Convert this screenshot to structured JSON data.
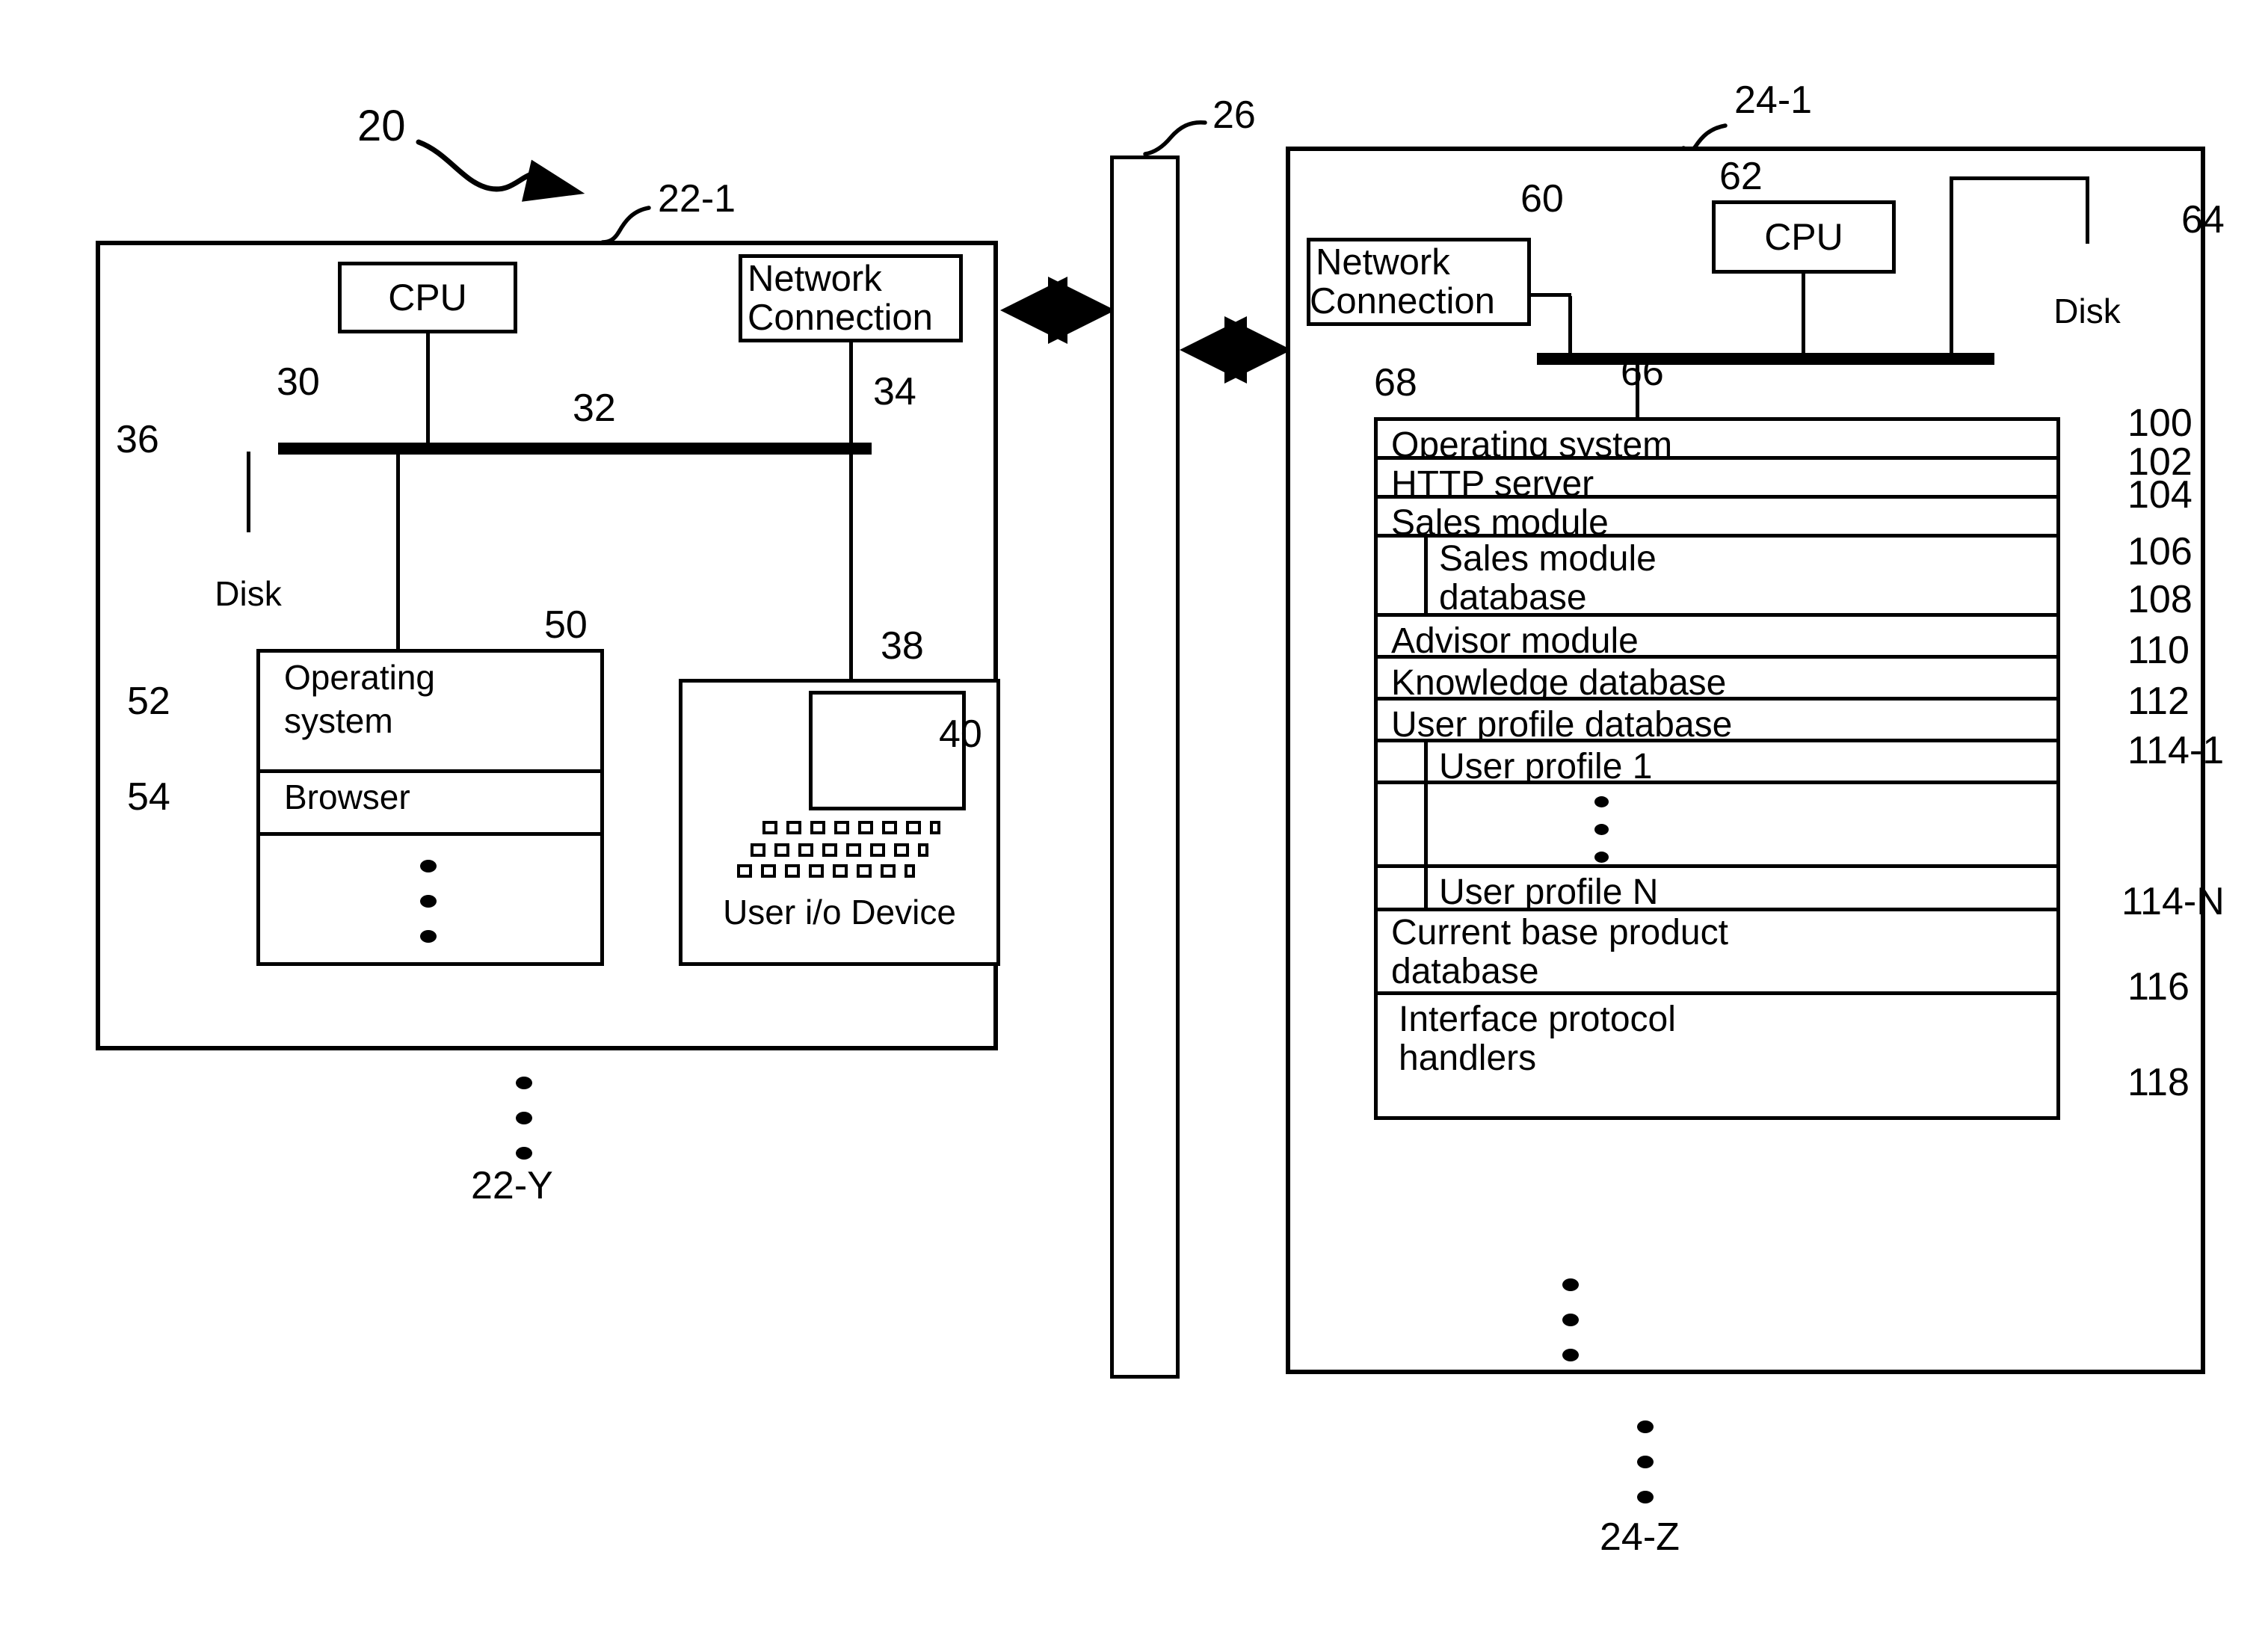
{
  "figure": {
    "type": "patent-system-block-diagram",
    "system_ref": "20"
  },
  "client": {
    "ref": "22-1",
    "bottom_ref": "22-Y",
    "cpu": {
      "label": "CPU",
      "ref": "30"
    },
    "bus": {
      "ref": "32"
    },
    "network_connection": {
      "label": "Network\nConnection",
      "line1": "Network",
      "line2": "Connection",
      "ref": "34"
    },
    "disk": {
      "label": "Disk",
      "ref": "36"
    },
    "memory": {
      "ref": "50",
      "rows": [
        {
          "label": "Operating system",
          "line1": "Operating",
          "line2": "system",
          "ref": "52"
        },
        {
          "label": "Browser",
          "ref": "54"
        },
        {
          "label": "",
          "ref": ""
        }
      ]
    },
    "user_io_device": {
      "label": "User i/o Device",
      "ref": "38",
      "monitor_ref": "40"
    }
  },
  "network": {
    "ref": "26"
  },
  "server": {
    "ref": "24-1",
    "bottom_ref": "24-Z",
    "network_connection": {
      "line1": "Network",
      "line2": "Connection",
      "ref": "60"
    },
    "cpu": {
      "label": "CPU",
      "ref": "62"
    },
    "disk": {
      "label": "Disk",
      "ref": "64"
    },
    "bus": {
      "ref": "66"
    },
    "memory": {
      "ref": "68"
    },
    "stack_rows": [
      {
        "label": "Operating system",
        "ref": "100",
        "indent": 0
      },
      {
        "label": "HTTP server",
        "ref": "102",
        "indent": 0
      },
      {
        "label": "Sales module",
        "ref": "104",
        "indent": 0
      },
      {
        "label": "Sales module database",
        "line1": "Sales module",
        "line2": "database",
        "ref": "106",
        "indent": 1
      },
      {
        "label": "Advisor module",
        "ref": "108",
        "indent": 0
      },
      {
        "label": "Knowledge database",
        "ref": "110",
        "indent": 0
      },
      {
        "label": "User profile database",
        "ref": "112",
        "indent": 0
      },
      {
        "label": "User profile 1",
        "ref": "114-1",
        "indent": 1
      },
      {
        "label": "",
        "ref": "",
        "indent": 1
      },
      {
        "label": "User profile N",
        "ref": "114-N",
        "indent": 1
      },
      {
        "label": "Current base product database",
        "line1": "Current base product",
        "line2": "database",
        "ref": "116",
        "indent": 0
      },
      {
        "label": "Interface protocol handlers",
        "line1": "Interface protocol",
        "line2": "handlers",
        "ref": "118",
        "indent": 0
      }
    ]
  },
  "colors": {
    "ink": "#000000",
    "paper": "#ffffff"
  }
}
